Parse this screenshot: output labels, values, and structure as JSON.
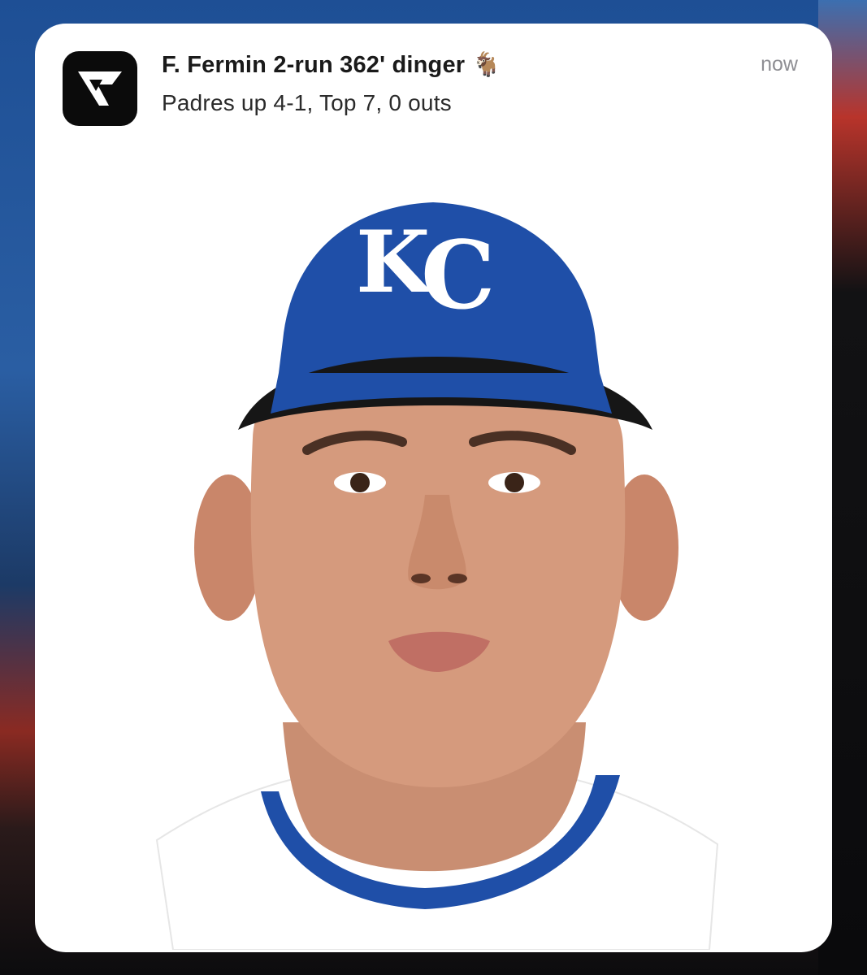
{
  "notification": {
    "app_icon": "scores-app-logo-icon",
    "title": "F. Fermin 2-run 362' dinger 🐐",
    "subtitle": "Padres up 4-1, Top 7, 0 outs",
    "timestamp": "now",
    "image": {
      "cap_logo": "KC",
      "cap_color": "#1f4fa8",
      "jersey_color": "#ffffff"
    }
  }
}
